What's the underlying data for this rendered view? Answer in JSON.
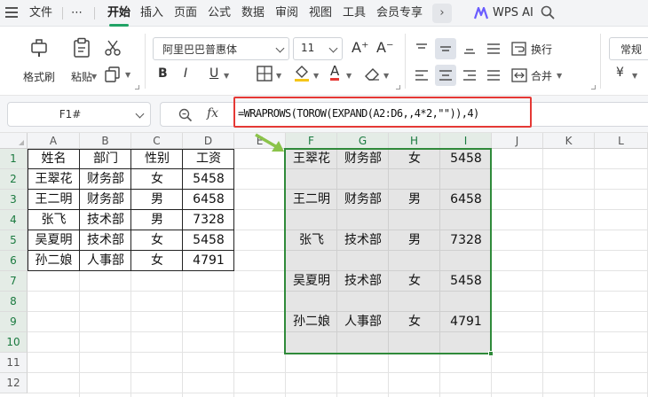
{
  "menu": {
    "file": "文件",
    "more_dots": "⋯",
    "tabs": [
      "开始",
      "插入",
      "页面",
      "公式",
      "数据",
      "审阅",
      "视图",
      "工具",
      "会员专享"
    ],
    "active_tab": "开始",
    "wps_ai": "WPS AI"
  },
  "ribbon": {
    "format_painter": "格式刷",
    "paste": "粘贴",
    "font_name": "阿里巴巴普惠体",
    "font_size": "11",
    "bold": "B",
    "italic": "I",
    "underline": "U",
    "font_color_glyph": "A",
    "grow_font": "A⁺",
    "shrink_font": "A⁻",
    "wrap_text": "换行",
    "merge": "合并",
    "number_format": "常规",
    "currency": "¥",
    "accent_color": "#21a366"
  },
  "formula_bar": {
    "name_box": "F1#",
    "fx_label": "fx",
    "formula": "=WRAPROWS(TOROW(EXPAND(A2:D6,,4*2,\"\")),4)"
  },
  "sheet": {
    "columns": [
      "A",
      "B",
      "C",
      "D",
      "E",
      "F",
      "G",
      "H",
      "I",
      "J",
      "K",
      "L"
    ],
    "rows": [
      "1",
      "2",
      "3",
      "4",
      "5",
      "6",
      "7",
      "8",
      "9",
      "10",
      "11",
      "12"
    ],
    "source_header": [
      "姓名",
      "部门",
      "性别",
      "工资"
    ],
    "source_rows": [
      [
        "王翠花",
        "财务部",
        "女",
        "5458"
      ],
      [
        "王二明",
        "财务部",
        "男",
        "6458"
      ],
      [
        "张飞",
        "技术部",
        "男",
        "7328"
      ],
      [
        "吴夏明",
        "技术部",
        "女",
        "5458"
      ],
      [
        "孙二娘",
        "人事部",
        "女",
        "4791"
      ]
    ],
    "result_rows": [
      [
        "王翠花",
        "财务部",
        "女",
        "5458"
      ],
      [
        "王二明",
        "财务部",
        "男",
        "6458"
      ],
      [
        "张飞",
        "技术部",
        "男",
        "7328"
      ],
      [
        "吴夏明",
        "技术部",
        "女",
        "5458"
      ],
      [
        "孙二娘",
        "人事部",
        "女",
        "4791"
      ]
    ],
    "result_border_color": "#2f8a3a",
    "formula_highlight_color": "#e53935",
    "arrow_color": "#8bc34a"
  }
}
